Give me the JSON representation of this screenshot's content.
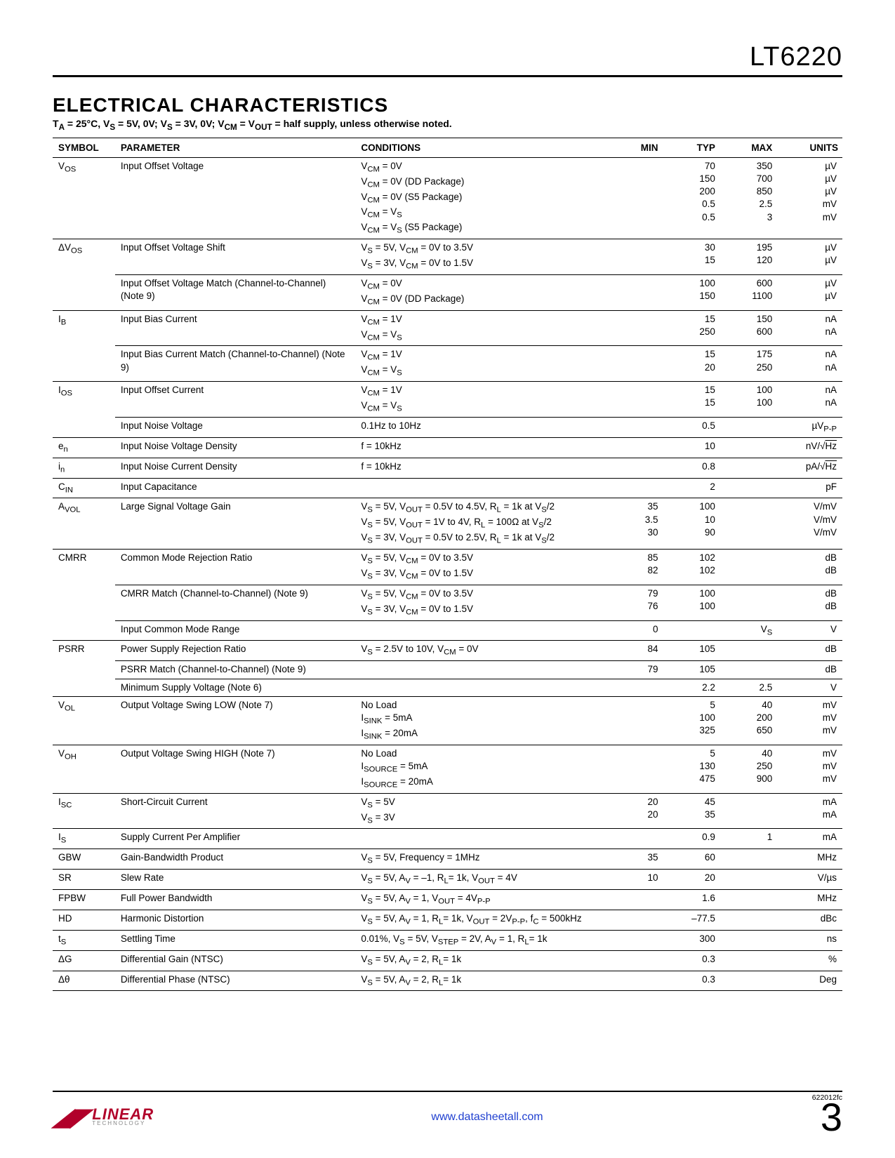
{
  "header": {
    "part_number": "LT6220"
  },
  "section_title": "ELECTRICAL CHARACTERISTICS",
  "conditions_note_html": "T<sub>A</sub> = 25°C, V<sub>S</sub> = 5V, 0V; V<sub>S</sub> = 3V, 0V; V<sub>CM</sub> = V<sub>OUT</sub> = half supply, unless otherwise noted.",
  "columns": {
    "symbol": "SYMBOL",
    "parameter": "PARAMETER",
    "conditions": "CONDITIONS",
    "min": "MIN",
    "typ": "TYP",
    "max": "MAX",
    "units": "UNITS"
  },
  "rows": [
    {
      "group": true,
      "symbol_html": "V<sub>OS</sub>",
      "parameter": "Input Offset Voltage",
      "conditions_html": [
        "V<sub>CM</sub> = 0V",
        "V<sub>CM</sub> = 0V (DD Package)",
        "V<sub>CM</sub> = 0V (S5 Package)",
        "V<sub>CM</sub> = V<sub>S</sub>",
        "V<sub>CM</sub> = V<sub>S</sub> (S5 Package)"
      ],
      "min": [
        "",
        "",
        "",
        "",
        ""
      ],
      "typ": [
        "70",
        "150",
        "200",
        "0.5",
        "0.5"
      ],
      "max": [
        "350",
        "700",
        "850",
        "2.5",
        "3"
      ],
      "units": [
        "µV",
        "µV",
        "µV",
        "mV",
        "mV"
      ]
    },
    {
      "group": true,
      "symbol_html": "ΔV<sub>OS</sub>",
      "parameter": "Input Offset Voltage Shift",
      "conditions_html": [
        "V<sub>S</sub> = 5V, V<sub>CM</sub> = 0V to 3.5V",
        "V<sub>S</sub> = 3V, V<sub>CM</sub> = 0V to 1.5V"
      ],
      "min": [
        "",
        ""
      ],
      "typ": [
        "30",
        "15"
      ],
      "max": [
        "195",
        "120"
      ],
      "units": [
        "µV",
        "µV"
      ]
    },
    {
      "sub": true,
      "symbol_html": "",
      "parameter": "Input Offset Voltage Match (Channel-to-Channel) (Note 9)",
      "conditions_html": [
        "V<sub>CM</sub> = 0V",
        "V<sub>CM</sub> = 0V (DD Package)"
      ],
      "min": [
        "",
        ""
      ],
      "typ": [
        "100",
        "150"
      ],
      "max": [
        "600",
        "1100"
      ],
      "units": [
        "µV",
        "µV"
      ]
    },
    {
      "group": true,
      "symbol_html": "I<sub>B</sub>",
      "parameter": "Input Bias Current",
      "conditions_html": [
        "V<sub>CM</sub> = 1V",
        "V<sub>CM</sub> = V<sub>S</sub>"
      ],
      "min": [
        "",
        ""
      ],
      "typ": [
        "15",
        "250"
      ],
      "max": [
        "150",
        "600"
      ],
      "units": [
        "nA",
        "nA"
      ]
    },
    {
      "sub": true,
      "symbol_html": "",
      "parameter": "Input Bias Current Match (Channel-to-Channel) (Note 9)",
      "conditions_html": [
        "V<sub>CM</sub> = 1V",
        "V<sub>CM</sub> = V<sub>S</sub>"
      ],
      "min": [
        "",
        ""
      ],
      "typ": [
        "15",
        "20"
      ],
      "max": [
        "175",
        "250"
      ],
      "units": [
        "nA",
        "nA"
      ]
    },
    {
      "group": true,
      "symbol_html": "I<sub>OS</sub>",
      "parameter": "Input Offset Current",
      "conditions_html": [
        "V<sub>CM</sub> = 1V",
        "V<sub>CM</sub> = V<sub>S</sub>"
      ],
      "min": [
        "",
        ""
      ],
      "typ": [
        "15",
        "15"
      ],
      "max": [
        "100",
        "100"
      ],
      "units": [
        "nA",
        "nA"
      ]
    },
    {
      "sub": true,
      "symbol_html": "",
      "parameter": "Input Noise Voltage",
      "conditions_html": [
        "0.1Hz to 10Hz"
      ],
      "min": [
        ""
      ],
      "typ": [
        "0.5"
      ],
      "max": [
        ""
      ],
      "units_html": [
        "µV<sub>P-P</sub>"
      ]
    },
    {
      "group": true,
      "symbol_html": "e<sub>n</sub>",
      "parameter": "Input Noise Voltage Density",
      "conditions_html": [
        "f = 10kHz"
      ],
      "min": [
        ""
      ],
      "typ": [
        "10"
      ],
      "max": [
        ""
      ],
      "units_html": [
        "nV/√<span class='radical'>Hz</span>"
      ]
    },
    {
      "group": true,
      "symbol_html": "i<sub>n</sub>",
      "parameter": "Input Noise Current Density",
      "conditions_html": [
        "f = 10kHz"
      ],
      "min": [
        ""
      ],
      "typ": [
        "0.8"
      ],
      "max": [
        ""
      ],
      "units_html": [
        "pA/√<span class='radical'>Hz</span>"
      ]
    },
    {
      "group": true,
      "symbol_html": "C<sub>IN</sub>",
      "parameter": "Input Capacitance",
      "conditions_html": [
        ""
      ],
      "min": [
        ""
      ],
      "typ": [
        "2"
      ],
      "max": [
        ""
      ],
      "units": [
        "pF"
      ]
    },
    {
      "group": true,
      "symbol_html": "A<sub>VOL</sub>",
      "parameter": "Large Signal Voltage Gain",
      "conditions_html": [
        "V<sub>S</sub> = 5V, V<sub>OUT</sub> = 0.5V to 4.5V, R<sub>L</sub> = 1k at V<sub>S</sub>/2",
        "V<sub>S</sub> = 5V, V<sub>OUT</sub> = 1V to 4V, R<sub>L</sub> = 100Ω at V<sub>S</sub>/2",
        "V<sub>S</sub> = 3V, V<sub>OUT</sub> = 0.5V to 2.5V, R<sub>L</sub> = 1k at V<sub>S</sub>/2"
      ],
      "min": [
        "35",
        "3.5",
        "30"
      ],
      "typ": [
        "100",
        "10",
        "90"
      ],
      "max": [
        "",
        "",
        ""
      ],
      "units": [
        "V/mV",
        "V/mV",
        "V/mV"
      ]
    },
    {
      "group": true,
      "symbol_html": "CMRR",
      "parameter": "Common Mode Rejection Ratio",
      "conditions_html": [
        "V<sub>S</sub> = 5V, V<sub>CM</sub> = 0V to 3.5V",
        "V<sub>S</sub> = 3V, V<sub>CM</sub> = 0V to 1.5V"
      ],
      "min": [
        "85",
        "82"
      ],
      "typ": [
        "102",
        "102"
      ],
      "max": [
        "",
        ""
      ],
      "units": [
        "dB",
        "dB"
      ]
    },
    {
      "sub": true,
      "symbol_html": "",
      "parameter": "CMRR Match (Channel-to-Channel) (Note 9)",
      "conditions_html": [
        "V<sub>S</sub> = 5V, V<sub>CM</sub> = 0V to 3.5V",
        "V<sub>S</sub> = 3V, V<sub>CM</sub> = 0V to 1.5V"
      ],
      "min": [
        "79",
        "76"
      ],
      "typ": [
        "100",
        "100"
      ],
      "max": [
        "",
        ""
      ],
      "units": [
        "dB",
        "dB"
      ]
    },
    {
      "sub": true,
      "symbol_html": "",
      "parameter": "Input Common Mode Range",
      "conditions_html": [
        ""
      ],
      "min": [
        "0"
      ],
      "typ": [
        ""
      ],
      "max_html": [
        "V<sub>S</sub>"
      ],
      "units": [
        "V"
      ]
    },
    {
      "group": true,
      "symbol_html": "PSRR",
      "parameter": "Power Supply Rejection Ratio",
      "conditions_html": [
        "V<sub>S</sub> = 2.5V to 10V, V<sub>CM</sub> = 0V"
      ],
      "min": [
        "84"
      ],
      "typ": [
        "105"
      ],
      "max": [
        ""
      ],
      "units": [
        "dB"
      ]
    },
    {
      "sub": true,
      "symbol_html": "",
      "parameter": "PSRR Match (Channel-to-Channel) (Note 9)",
      "conditions_html": [
        ""
      ],
      "min": [
        "79"
      ],
      "typ": [
        "105"
      ],
      "max": [
        ""
      ],
      "units": [
        "dB"
      ]
    },
    {
      "sub": true,
      "symbol_html": "",
      "parameter": "Minimum Supply Voltage (Note 6)",
      "conditions_html": [
        ""
      ],
      "min": [
        ""
      ],
      "typ": [
        "2.2"
      ],
      "max": [
        "2.5"
      ],
      "units": [
        "V"
      ]
    },
    {
      "group": true,
      "symbol_html": "V<sub>OL</sub>",
      "parameter": "Output Voltage Swing LOW (Note 7)",
      "conditions_html": [
        "No Load",
        "I<sub>SINK</sub> = 5mA",
        "I<sub>SINK</sub> = 20mA"
      ],
      "min": [
        "",
        "",
        ""
      ],
      "typ": [
        "5",
        "100",
        "325"
      ],
      "max": [
        "40",
        "200",
        "650"
      ],
      "units": [
        "mV",
        "mV",
        "mV"
      ]
    },
    {
      "group": true,
      "symbol_html": "V<sub>OH</sub>",
      "parameter": "Output Voltage Swing HIGH (Note 7)",
      "conditions_html": [
        "No Load",
        "I<sub>SOURCE</sub> = 5mA",
        "I<sub>SOURCE</sub> = 20mA"
      ],
      "min": [
        "",
        "",
        ""
      ],
      "typ": [
        "5",
        "130",
        "475"
      ],
      "max": [
        "40",
        "250",
        "900"
      ],
      "units": [
        "mV",
        "mV",
        "mV"
      ]
    },
    {
      "group": true,
      "symbol_html": "I<sub>SC</sub>",
      "parameter": "Short-Circuit Current",
      "conditions_html": [
        "V<sub>S</sub> = 5V",
        "V<sub>S</sub> = 3V"
      ],
      "min": [
        "20",
        "20"
      ],
      "typ": [
        "45",
        "35"
      ],
      "max": [
        "",
        ""
      ],
      "units": [
        "mA",
        "mA"
      ]
    },
    {
      "group": true,
      "symbol_html": "I<sub>S</sub>",
      "parameter": "Supply Current Per Amplifier",
      "conditions_html": [
        ""
      ],
      "min": [
        ""
      ],
      "typ": [
        "0.9"
      ],
      "max": [
        "1"
      ],
      "units": [
        "mA"
      ]
    },
    {
      "group": true,
      "symbol_html": "GBW",
      "parameter": "Gain-Bandwidth Product",
      "conditions_html": [
        "V<sub>S</sub> = 5V, Frequency = 1MHz"
      ],
      "min": [
        "35"
      ],
      "typ": [
        "60"
      ],
      "max": [
        ""
      ],
      "units": [
        "MHz"
      ]
    },
    {
      "group": true,
      "symbol_html": "SR",
      "parameter": "Slew Rate",
      "conditions_html": [
        "V<sub>S</sub> = 5V, A<sub>V</sub> = –1, R<sub>L</sub>= 1k, V<sub>OUT</sub> = 4V"
      ],
      "min": [
        "10"
      ],
      "typ": [
        "20"
      ],
      "max": [
        ""
      ],
      "units": [
        "V/µs"
      ]
    },
    {
      "group": true,
      "symbol_html": "FPBW",
      "parameter": "Full Power Bandwidth",
      "conditions_html": [
        "V<sub>S</sub> = 5V, A<sub>V</sub> = 1, V<sub>OUT</sub> = 4V<sub>P-P</sub>"
      ],
      "min": [
        ""
      ],
      "typ": [
        "1.6"
      ],
      "max": [
        ""
      ],
      "units": [
        "MHz"
      ]
    },
    {
      "group": true,
      "symbol_html": "HD",
      "parameter": "Harmonic Distortion",
      "conditions_html": [
        "V<sub>S</sub> = 5V, A<sub>V</sub> = 1, R<sub>L</sub>= 1k, V<sub>OUT</sub> = 2V<sub>P-P</sub>, f<sub>C</sub> = 500kHz"
      ],
      "min": [
        ""
      ],
      "typ": [
        "–77.5"
      ],
      "max": [
        ""
      ],
      "units": [
        "dBc"
      ]
    },
    {
      "group": true,
      "symbol_html": "t<sub>S</sub>",
      "parameter": "Settling Time",
      "conditions_html": [
        "0.01%, V<sub>S</sub> = 5V, V<sub>STEP</sub> = 2V, A<sub>V</sub> = 1, R<sub>L</sub>= 1k"
      ],
      "min": [
        ""
      ],
      "typ": [
        "300"
      ],
      "max": [
        ""
      ],
      "units": [
        "ns"
      ]
    },
    {
      "group": true,
      "symbol_html": "ΔG",
      "parameter": "Differential Gain (NTSC)",
      "conditions_html": [
        "V<sub>S</sub> = 5V, A<sub>V</sub> = 2, R<sub>L</sub>= 1k"
      ],
      "min": [
        ""
      ],
      "typ": [
        "0.3"
      ],
      "max": [
        ""
      ],
      "units": [
        "%"
      ]
    },
    {
      "group": true,
      "symbol_html": "Δθ",
      "parameter": "Differential Phase (NTSC)",
      "conditions_html": [
        "V<sub>S</sub> = 5V, A<sub>V</sub> = 2, R<sub>L</sub>= 1k"
      ],
      "min": [
        ""
      ],
      "typ": [
        "0.3"
      ],
      "max": [
        ""
      ],
      "units": [
        "Deg"
      ]
    }
  ],
  "footer": {
    "doc_id": "622012fc",
    "logo_main": "LINEAR",
    "logo_sub": "TECHNOLOGY",
    "link": "www.datasheetall.com",
    "page_num": "3"
  }
}
